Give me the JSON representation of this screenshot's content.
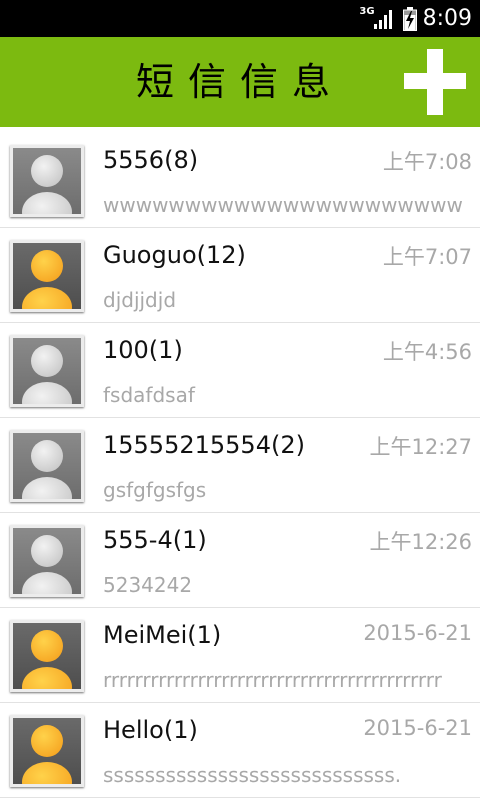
{
  "status_bar": {
    "network": "3G",
    "time": "8:09"
  },
  "header": {
    "title": "短信信息",
    "add_icon": "plus-icon"
  },
  "conversations": [
    {
      "name": "5556(8)",
      "time": "上午7:08",
      "preview": "wwwwwwwwwwwwwwwwwwwwww",
      "avatar": "gray"
    },
    {
      "name": "Guoguo(12)",
      "time": "上午7:07",
      "preview": "djdjjdjd",
      "avatar": "orange"
    },
    {
      "name": "100(1)",
      "time": "上午4:56",
      "preview": "fsdafdsaf",
      "avatar": "gray"
    },
    {
      "name": "15555215554(2)",
      "time": "上午12:27",
      "preview": "gsfgfgsfgs",
      "avatar": "gray"
    },
    {
      "name": "555-4(1)",
      "time": "上午12:26",
      "preview": "5234242",
      "avatar": "gray"
    },
    {
      "name": "MeiMei(1)",
      "time": "2015-6-21",
      "preview": "rrrrrrrrrrrrrrrrrrrrrrrrrrrrrrrrrrrrrrrrrrr",
      "avatar": "orange"
    },
    {
      "name": "Hello(1)",
      "time": "2015-6-21",
      "preview": "ssssssssssssssssssssssssssss.",
      "avatar": "orange"
    }
  ],
  "colors": {
    "header_bg": "#7cba10",
    "status_bg": "#000000",
    "secondary_text": "#a8a8a8",
    "avatar_gray": "#c9c9c9",
    "avatar_orange": "#f6a623"
  }
}
